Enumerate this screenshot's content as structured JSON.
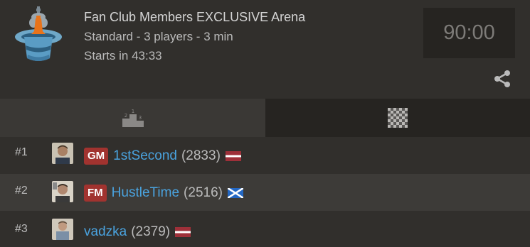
{
  "header": {
    "title": "Fan Club Members EXCLUSIVE Arena",
    "subtitle": "Standard - 3 players - 3 min",
    "starts": "Starts in 43:33",
    "clock": "90:00",
    "logo_icon": "arena-hat-king-icon",
    "share_icon": "share-icon"
  },
  "tabs": [
    {
      "icon": "podium-icon",
      "active": true
    },
    {
      "icon": "chessboard-icon",
      "active": false
    }
  ],
  "players": [
    {
      "rank": "#1",
      "title": "GM",
      "name": "1stSecond",
      "rating": "(2833)",
      "flag": "latvia-flag-icon"
    },
    {
      "rank": "#2",
      "title": "FM",
      "name": "HustleTime",
      "rating": "(2516)",
      "flag": "scotland-flag-icon"
    },
    {
      "rank": "#3",
      "title": "",
      "name": "vadzka",
      "rating": "(2379)",
      "flag": "latvia-flag-icon"
    }
  ],
  "colors": {
    "background": "#312f2c",
    "title_badge": "#a1332f",
    "username": "#4aa3df",
    "clock_bg": "#262421"
  }
}
